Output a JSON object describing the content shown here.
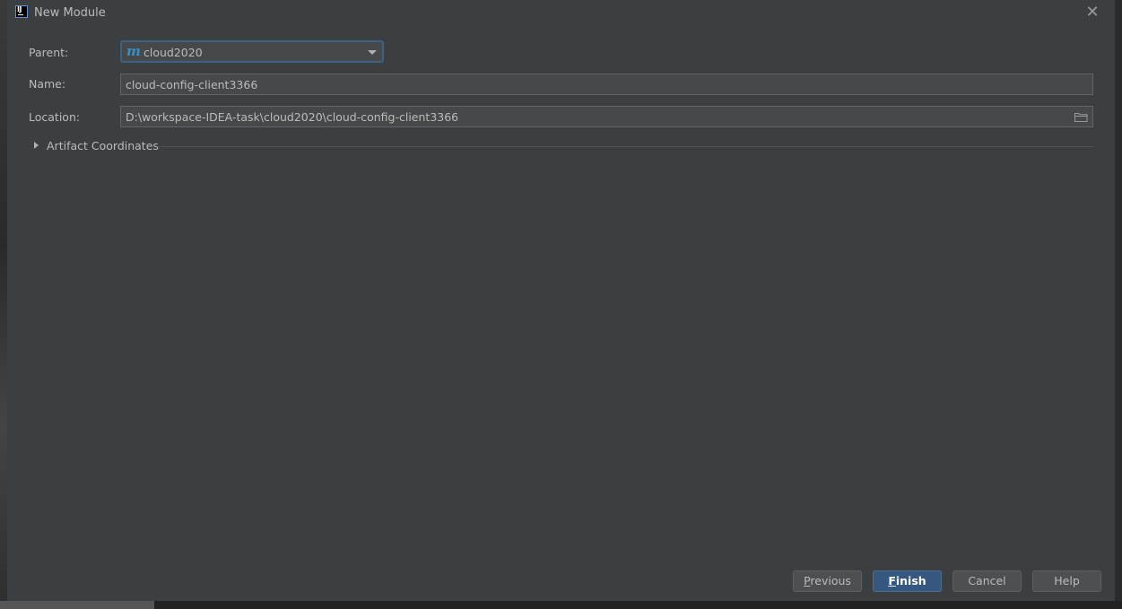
{
  "window": {
    "title": "New Module",
    "app_icon": "intellij-icon",
    "close_icon": "close-icon"
  },
  "form": {
    "parent": {
      "label": "Parent:",
      "value": "cloud2020",
      "icon": "maven-m-icon"
    },
    "name": {
      "label": "Name:",
      "value": "cloud-config-client3366"
    },
    "location": {
      "label": "Location:",
      "value": "D:\\workspace-IDEA-task\\cloud2020\\cloud-config-client3366",
      "browse_icon": "folder-icon"
    },
    "artifact_coordinates": {
      "label": "Artifact Coordinates",
      "expanded": false
    }
  },
  "buttons": {
    "previous": {
      "mnemonic": "P",
      "rest": "revious"
    },
    "finish": {
      "mnemonic": "F",
      "rest": "inish"
    },
    "cancel": "Cancel",
    "help": "Help"
  },
  "colors": {
    "dialog_bg": "#3c3f41",
    "field_bg": "#45494a",
    "accent_border": "#3d6185",
    "default_button": "#365880",
    "maven_icon": "#3592c4"
  }
}
